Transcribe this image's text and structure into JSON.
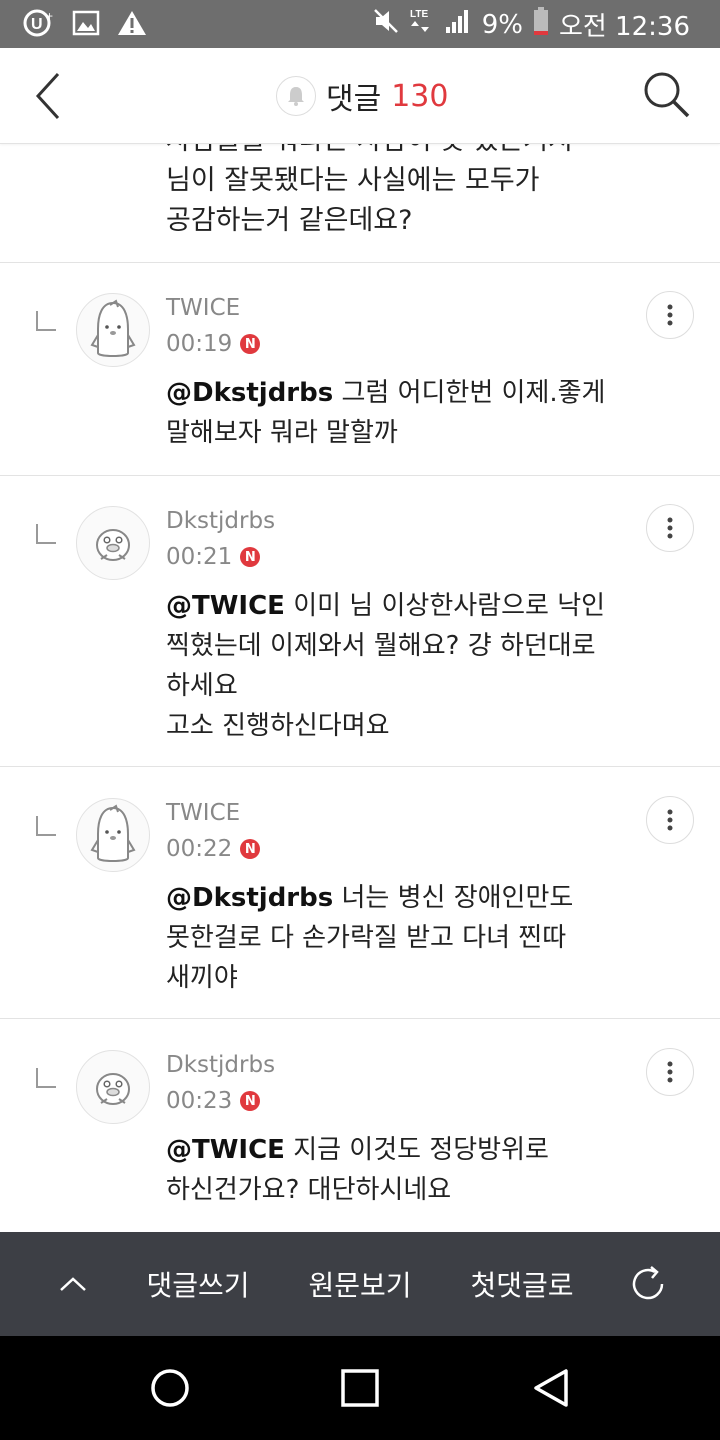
{
  "status_bar": {
    "battery": "9%",
    "time": "오전 12:36",
    "network": "LTE",
    "icons": [
      "u-plus-icon",
      "image-icon",
      "warning-icon",
      "mute-icon",
      "lte-icon",
      "signal-icon",
      "battery-icon"
    ]
  },
  "header": {
    "title": "댓글",
    "count": "130",
    "accent_color": "#e0393e"
  },
  "partial_comment": {
    "text": "사람들을 뭐라는 사람이 못 있는거지\n님이 잘못됐다는 사실에는 모두가\n공감하는거 같은데요?"
  },
  "comments": [
    {
      "author": "TWICE",
      "time": "00:19",
      "badge": "N",
      "avatar": "penguin-avatar",
      "mention": "@Dkstjdrbs",
      "text": " 그럼 어디한번 이제.좋게\n말해보자 뭐라 말할까"
    },
    {
      "author": "Dkstjdrbs",
      "time": "00:21",
      "badge": "N",
      "avatar": "duck-avatar",
      "mention": "@TWICE",
      "text": " 이미 님 이상한사람으로 낙인\n찍혔는데 이제와서 뭘해요? 걍 하던대로\n하세요\n고소 진행하신다며요"
    },
    {
      "author": "TWICE",
      "time": "00:22",
      "badge": "N",
      "avatar": "penguin-avatar",
      "mention": "@Dkstjdrbs",
      "text": " 너는 병신 장애인만도\n못한걸로 다 손가락질 받고 다녀 찐따\n새끼야"
    },
    {
      "author": "Dkstjdrbs",
      "time": "00:23",
      "badge": "N",
      "avatar": "duck-avatar",
      "mention": "@TWICE",
      "text": " 지금 이것도 정당방위로\n하신건가요? 대단하시네요"
    }
  ],
  "toolbar": {
    "write_label": "댓글쓰기",
    "original_label": "원문보기",
    "first_label": "첫댓글로",
    "background": "#3d3f45"
  }
}
